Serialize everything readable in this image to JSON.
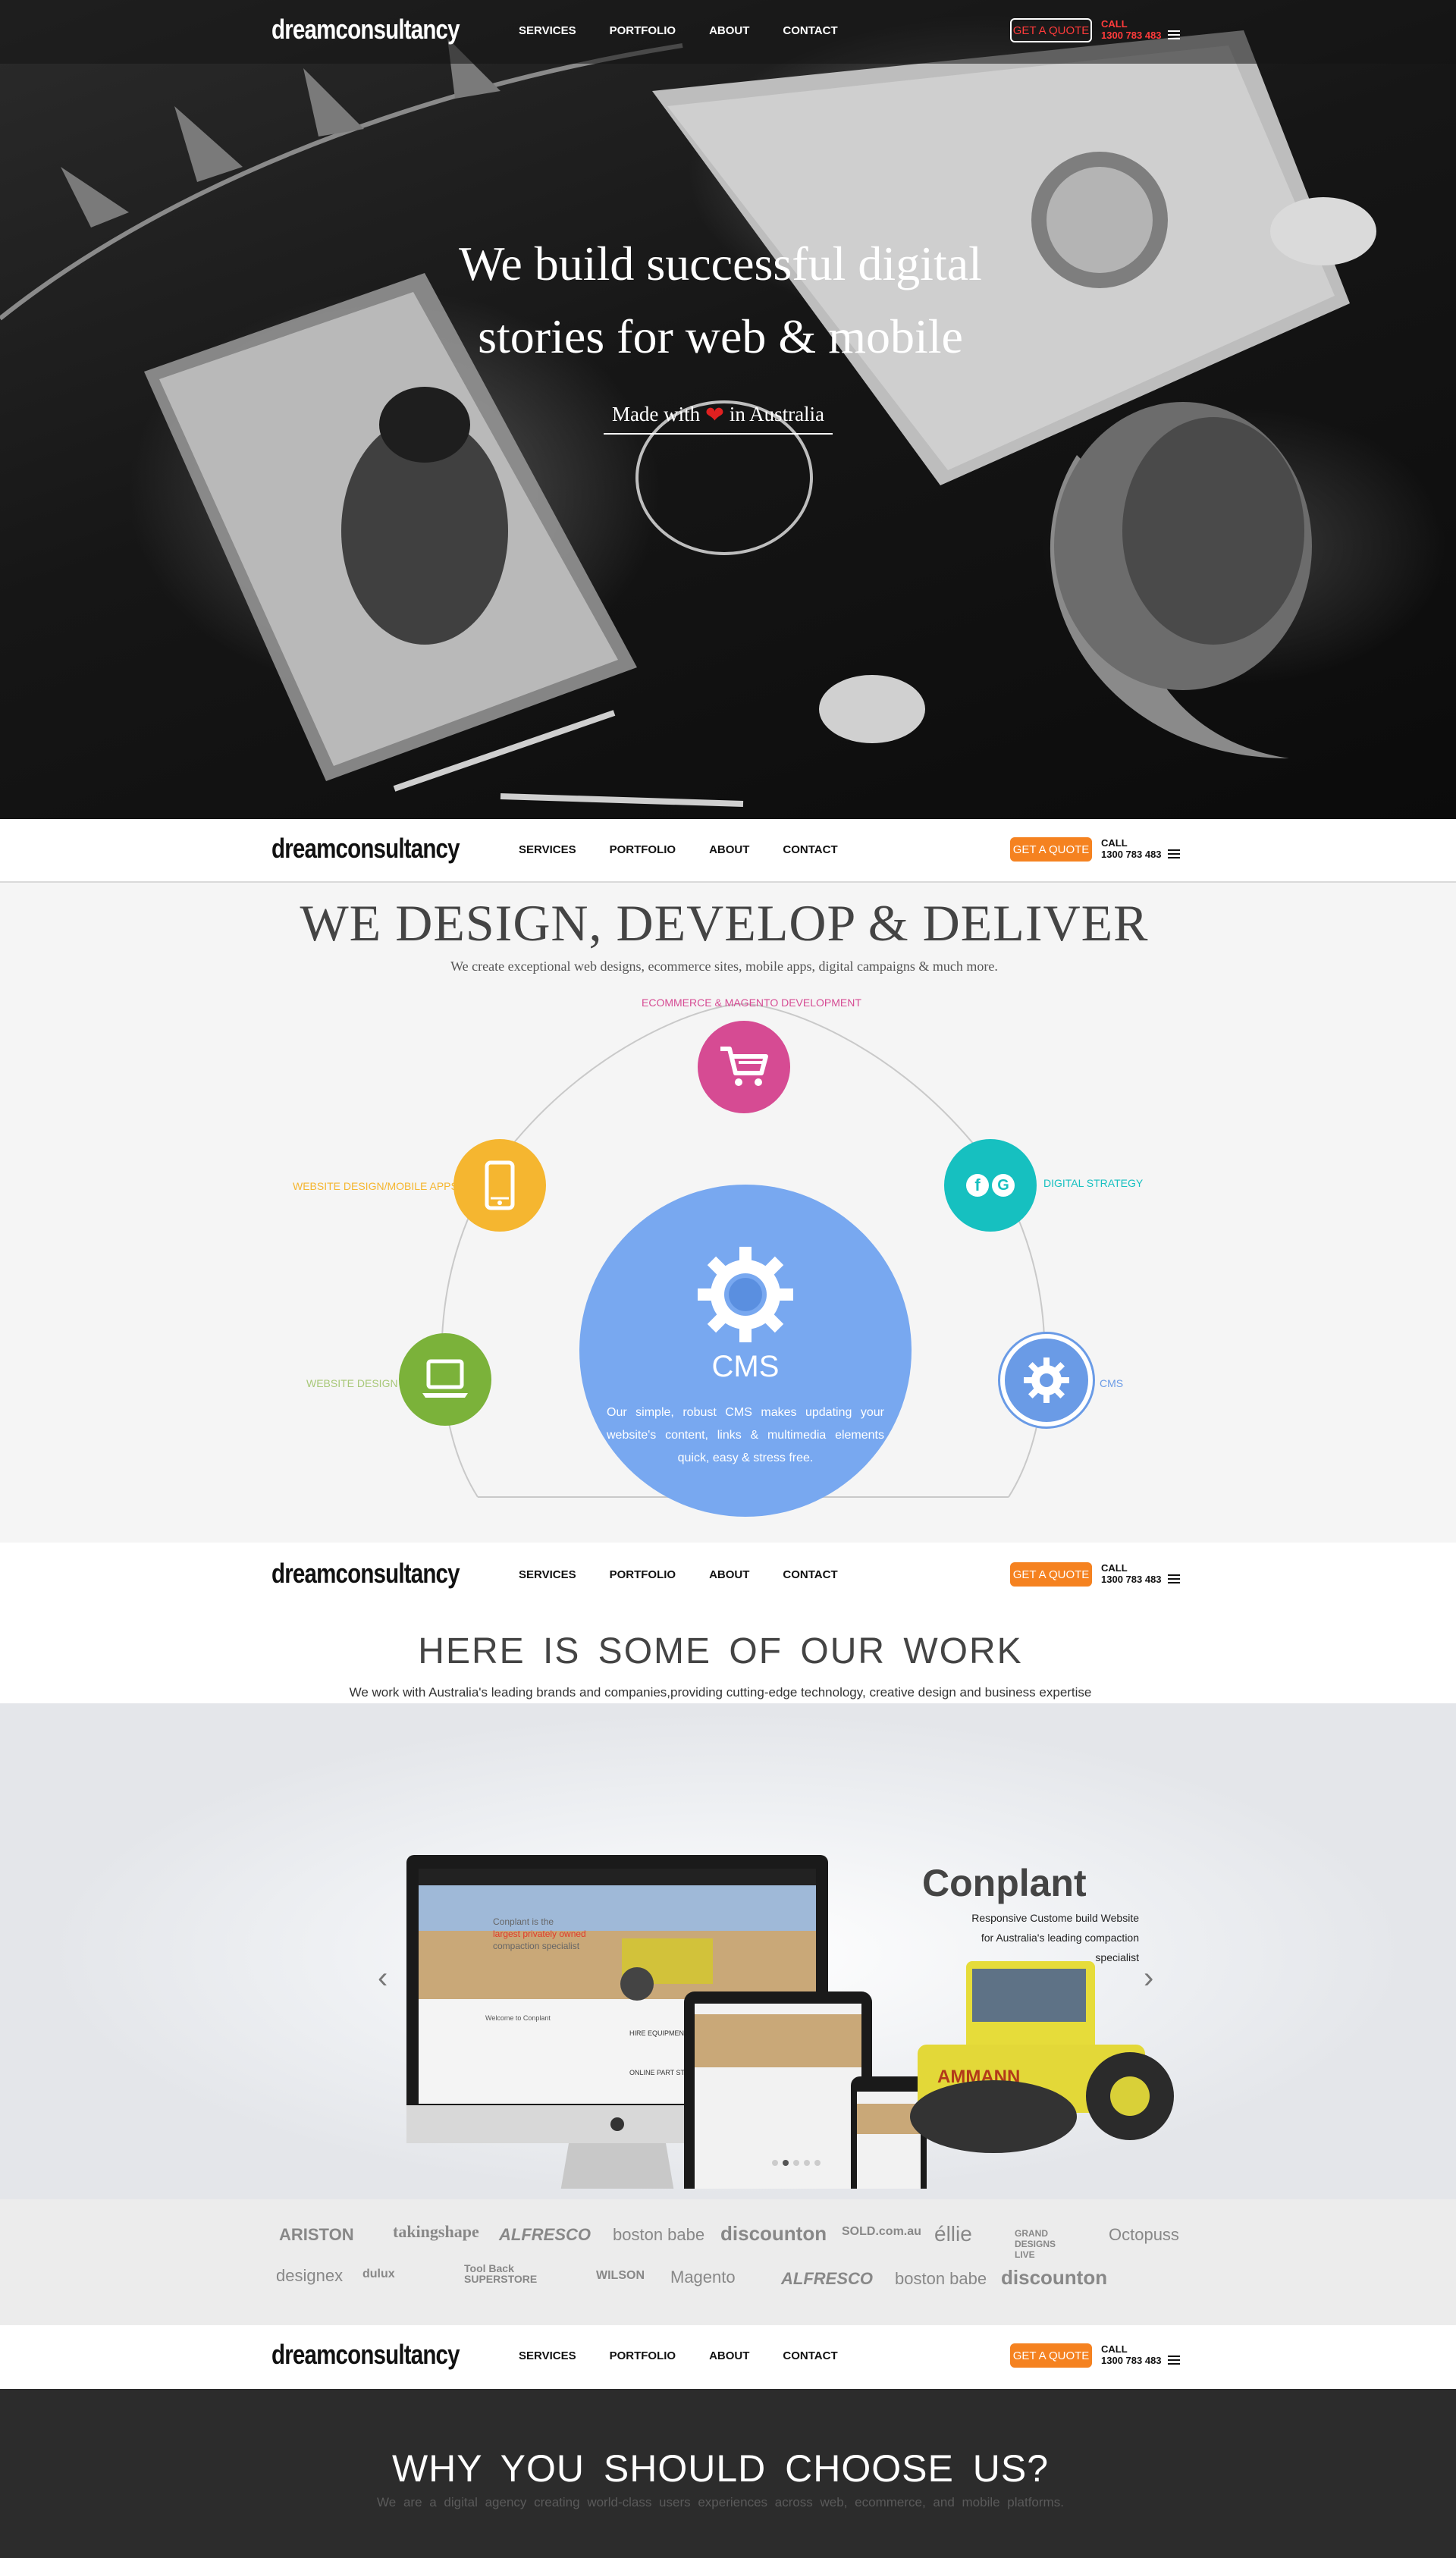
{
  "nav": {
    "logo": "dreamconsultancy",
    "links": [
      "SERVICES",
      "PORTFOLIO",
      "ABOUT",
      "CONTACT"
    ],
    "quote_label": "GET A QUOTE",
    "call_label": "CALL",
    "phone": "1300 783 483"
  },
  "hero": {
    "title_line1": "We build successful digital",
    "title_line2": "stories for web & mobile",
    "made_with": "Made with",
    "in_australia": "in Australia"
  },
  "services": {
    "title": "WE DESIGN, DEVELOP & DELIVER",
    "subtitle": "We create exceptional web designs, ecommerce sites, mobile apps, digital campaigns & much more.",
    "items": [
      {
        "label": "ECOMMERCE & MAGENTO DEVELOPMENT",
        "color": "#d64b93"
      },
      {
        "label": "WEBSITE DESIGN/MOBILE APPS",
        "color": "#f5b630"
      },
      {
        "label": "DIGITAL STRATEGY",
        "color": "#16c0c0"
      },
      {
        "label": "WEBSITE DESIGN",
        "color": "#7bb23a"
      },
      {
        "label": "CMS",
        "color": "#6a9be6"
      }
    ],
    "cms_title": "CMS",
    "cms_text": "Our simple, robust CMS makes updating your website's content, links & multimedia elements quick, easy & stress free."
  },
  "work": {
    "title": "HERE IS SOME OF OUR WORK",
    "subtitle": "We work with Australia's leading brands and companies,providing cutting-edge technology, creative design and business expertise",
    "slide": {
      "brand": "Conplant",
      "description": "Responsive Custome build Website for Australia's leading compaction specialist",
      "screen_headline_1": "Conplant is the",
      "screen_headline_2": "largest privately owned",
      "screen_headline_3": "compaction specialist",
      "welcome": "Welcome to Conplant",
      "hire": "HIRE EQUIPMENT",
      "online": "ONLINE PART STORE",
      "roller_brand": "AMMANN"
    },
    "slide_count": 5,
    "active_slide": 2
  },
  "clients": [
    "ARISTON",
    "takingshape",
    "ALFRESCO",
    "boston babe",
    "discounton",
    "SOLD.com.au",
    "éllie",
    "GRAND DESIGNS LIVE",
    "Octopuss",
    "designex",
    "dulux",
    "Tool Back SUPERSTORE",
    "WILSON",
    "Magento",
    "ALFRESCO",
    "boston babe",
    "discounton"
  ],
  "why": {
    "title": "WHY YOU SHOULD CHOOSE US?",
    "subtitle": "We are a digital agency creating world-class users experiences across web, ecommerce, and mobile platforms."
  }
}
